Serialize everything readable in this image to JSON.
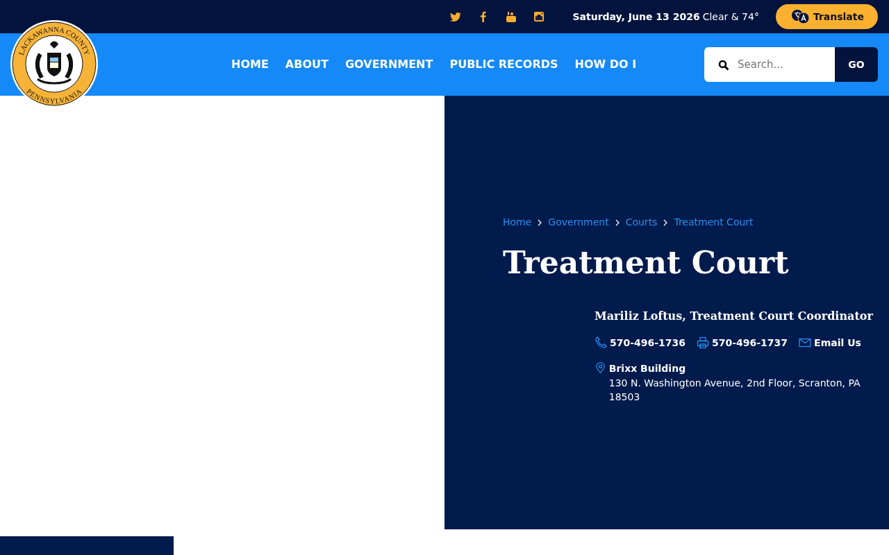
{
  "logo": {
    "top_text": "LACKAWANNA COUNTY",
    "bottom_text": "PENNSYLVANIA"
  },
  "top_bar": {
    "date": "Saturday, June 13 2026",
    "weather": "Clear & 74°",
    "translate_button": "Translate"
  },
  "nav": {
    "items": [
      "HOME",
      "ABOUT",
      "GOVERNMENT",
      "PUBLIC RECORDS",
      "HOW DO I"
    ]
  },
  "search": {
    "placeholder": "Search...",
    "button": "GO"
  },
  "breadcrumb": [
    "Home",
    "Government",
    "Courts",
    "Treatment Court"
  ],
  "page_title": "Treatment Court",
  "contact": {
    "name": "Mariliz Loftus, Treatment Court Coordinator",
    "phone": "570-496-1736",
    "fax": "570-496-1737",
    "email": "Email Us",
    "building": "Brixx Building",
    "address": "130 N. Washington Avenue, 2nd Floor, Scranton, PA 18503"
  }
}
